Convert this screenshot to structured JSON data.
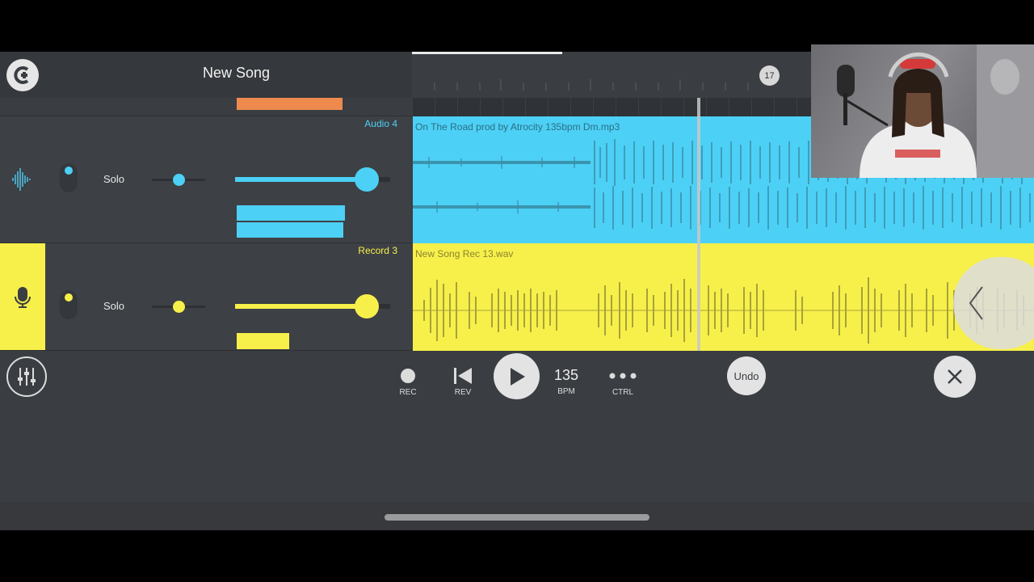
{
  "header": {
    "title": "New Song",
    "logo": "FL"
  },
  "timeline": {
    "bar_marker": "17"
  },
  "tracks": [
    {
      "name": "Audio 4",
      "solo_label": "Solo",
      "color": "#4dd0f5",
      "icon": "waveform-icon",
      "clip_name": "On The Road prod by Atrocity 135bpm Dm.mp3"
    },
    {
      "name": "Record 3",
      "solo_label": "Solo",
      "color": "#f7f04a",
      "icon": "microphone-icon",
      "clip_name": "New Song Rec 13.wav"
    }
  ],
  "transport": {
    "rec_label": "REC",
    "rev_label": "REV",
    "bpm_value": "135",
    "bpm_label": "BPM",
    "ctrl_label": "CTRL",
    "undo_label": "Undo"
  },
  "colors": {
    "accent_blue": "#4dd0f5",
    "accent_yellow": "#f7f04a",
    "orange": "#ee8a4e",
    "background": "#3a3d42"
  }
}
